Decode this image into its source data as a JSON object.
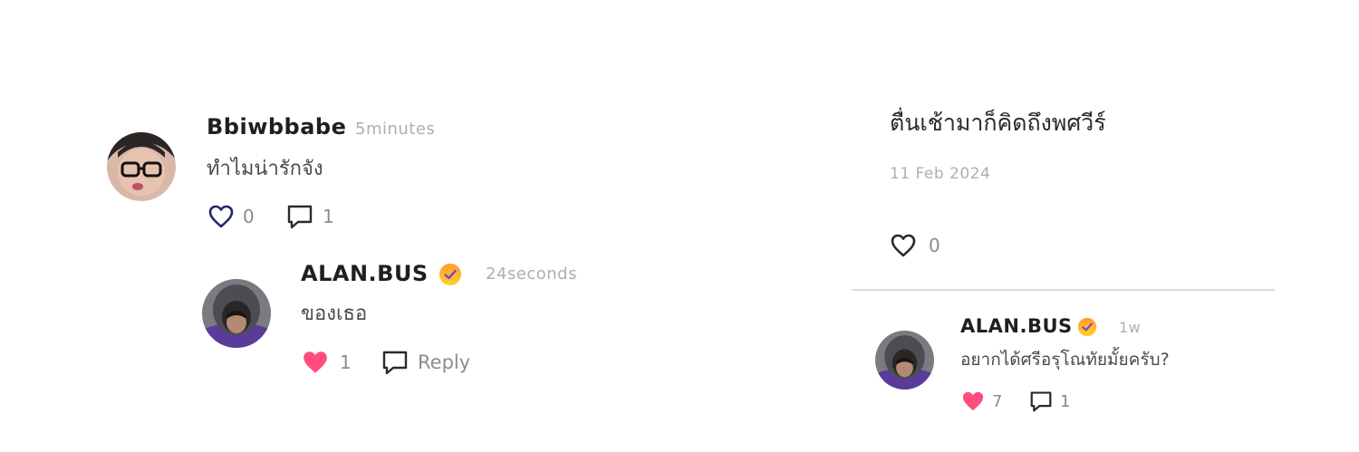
{
  "left_thread": {
    "comment": {
      "username": "Bbiwbbabe",
      "time": "5minutes",
      "text": "ทำไมน่ารักจัง",
      "likes": "0",
      "replies": "1"
    },
    "reply": {
      "username": "ALAN.BUS",
      "verified": true,
      "time": "24seconds",
      "text": "ของเธอ",
      "likes": "1",
      "reply_label": "Reply"
    }
  },
  "right_post": {
    "text": "ตื่นเช้ามาก็คิดถึงพศวีร์",
    "date": "11 Feb 2024",
    "likes": "0",
    "comment": {
      "username": "ALAN.BUS",
      "verified": true,
      "time": "1w",
      "text": "อยากได้ศรีอรุโณทัยมั้ยครับ?",
      "likes": "7",
      "replies": "1"
    }
  },
  "colors": {
    "heart_liked": "#ff4d7d",
    "heart_outline_blue": "#1f2a6b",
    "verified_badge_top": "#ff9a2e",
    "verified_badge_bottom": "#ffd12a",
    "timestamp": "#b7aab0",
    "divider": "#dcdde6"
  }
}
